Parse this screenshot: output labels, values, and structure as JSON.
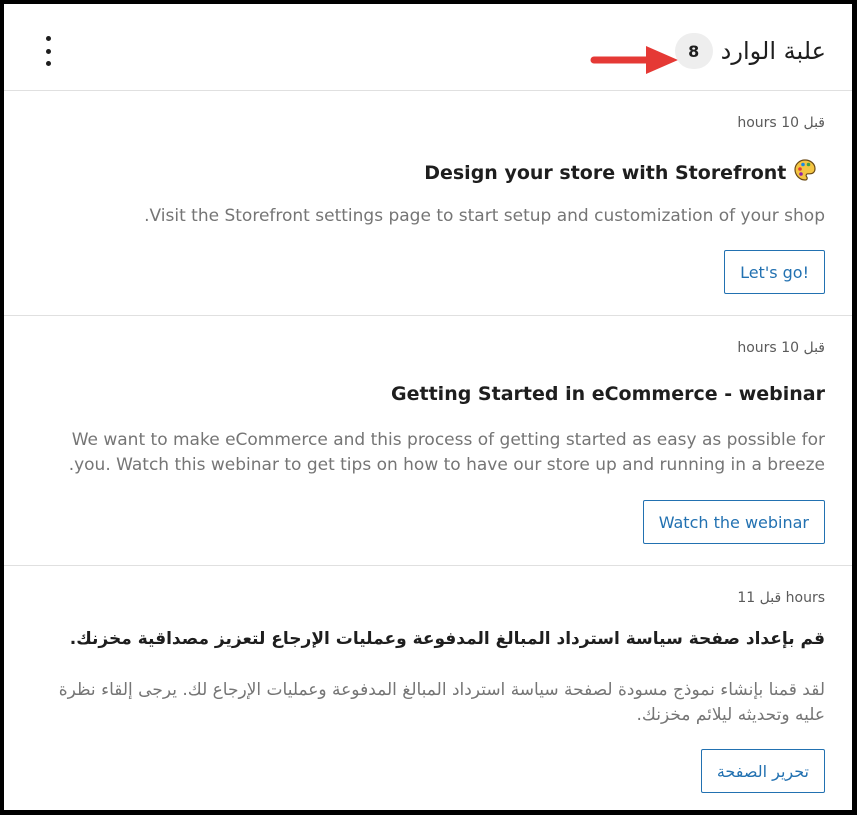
{
  "header": {
    "title": "علبة الوارد",
    "count": "8",
    "menu_icon": "kebab-menu-icon"
  },
  "notes": [
    {
      "time": "قبل 10 hours",
      "title": "Design your store with Storefront",
      "title_icon": "palette-icon",
      "body": "Visit the Storefront settings page to start setup and customization of your shop.",
      "action": "Let's go!"
    },
    {
      "time": "قبل 10 hours",
      "title": "Getting Started in eCommerce - webinar",
      "body": "We want to make eCommerce and this process of getting started as easy as possible for you. Watch this webinar to get tips on how to have our store up and running in a breeze.",
      "action": "Watch the webinar"
    },
    {
      "time": "قبل 11 hours",
      "title": "قم بإعداد صفحة سياسة استرداد المبالغ المدفوعة وعمليات الإرجاع لتعزيز مصداقية مخزنك.",
      "body": "لقد قمنا بإنشاء نموذج مسودة لصفحة سياسة استرداد المبالغ المدفوعة وعمليات الإرجاع لك. يرجى إلقاء نظرة عليه وتحديثه ليلائم مخزنك.",
      "action": "تحرير الصفحة"
    }
  ],
  "colors": {
    "accent": "#2271b1",
    "annotation_arrow": "#e53935",
    "badge_bg": "#eeeeee"
  }
}
